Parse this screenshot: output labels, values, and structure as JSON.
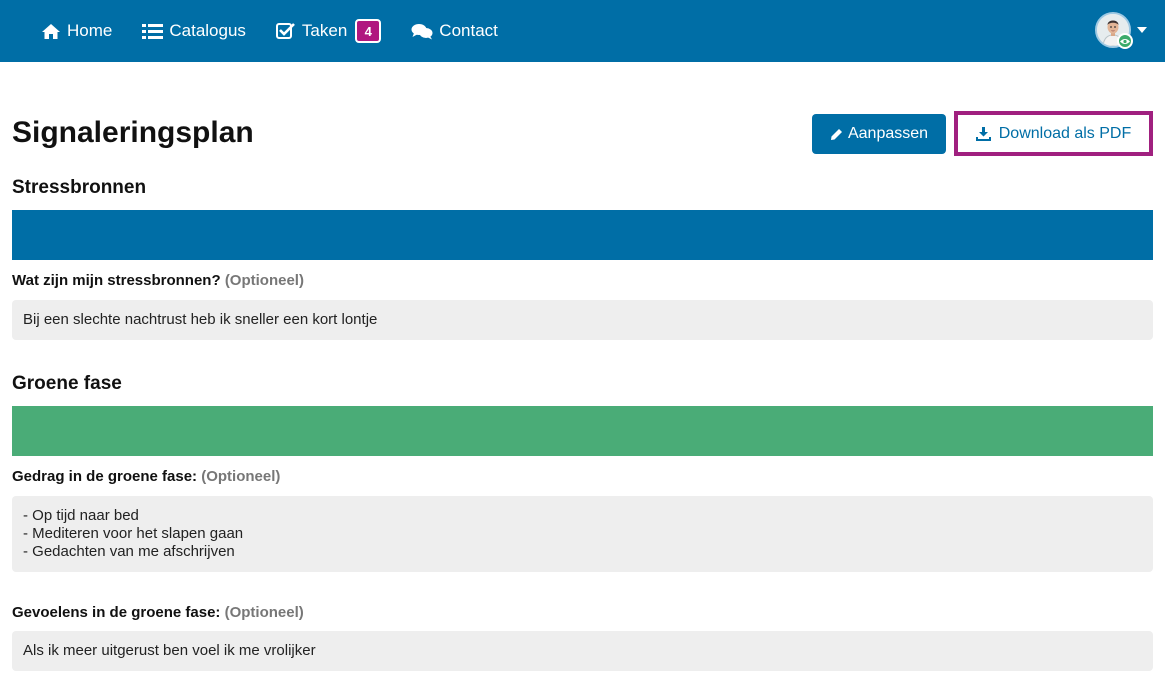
{
  "nav": {
    "items": [
      {
        "label": "Home",
        "icon": "home-icon"
      },
      {
        "label": "Catalogus",
        "icon": "list-icon"
      },
      {
        "label": "Taken",
        "icon": "check-square-icon",
        "badge": "4"
      },
      {
        "label": "Contact",
        "icon": "chat-icon"
      }
    ]
  },
  "page": {
    "title": "Signaleringsplan",
    "edit_label": "Aanpassen",
    "pdf_label": "Download als PDF"
  },
  "sections": {
    "stress": {
      "title": "Stressbronnen",
      "color": "#006ea6",
      "field_label": "Wat zijn mijn stressbronnen?",
      "optional": "(Optioneel)",
      "value": "Bij een slechte nachtrust heb ik sneller een kort lontje"
    },
    "green": {
      "title": "Groene fase",
      "color": "#4aac77",
      "behavior_label": "Gedrag in de groene fase:",
      "behavior_optional": "(Optioneel)",
      "behavior_lines": [
        "- Op tijd naar bed",
        "- Mediteren voor het slapen gaan",
        "- Gedachten van me afschrijven"
      ],
      "feelings_label": "Gevoelens in de groene fase:",
      "feelings_optional": "(Optioneel)",
      "feelings_value": "Als ik meer uitgerust ben voel ik me vrolijker"
    }
  },
  "colors": {
    "primary": "#006ea6",
    "badge": "#b0177f",
    "highlight_frame": "#a0207f"
  }
}
